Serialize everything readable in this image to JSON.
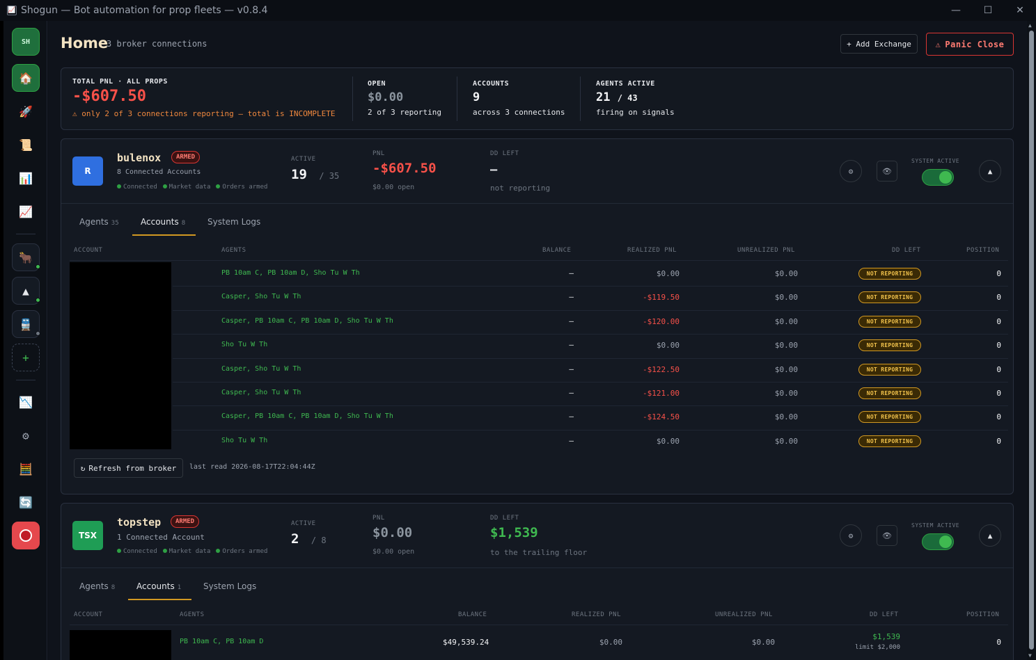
{
  "window": {
    "title": "Shogun — Bot automation for prop fleets — v0.8.4",
    "minimize": "—",
    "maximize": "☐",
    "close": "✕"
  },
  "sidebar": {
    "top_label": "SH",
    "items": [
      {
        "name": "home",
        "icon": "🏠"
      },
      {
        "name": "bots",
        "icon": "🚀"
      },
      {
        "name": "logs",
        "icon": "📜"
      },
      {
        "name": "stats",
        "icon": "📊"
      },
      {
        "name": "charts",
        "icon": "📈"
      },
      {
        "name": "bull-connection",
        "icon": "🐂"
      },
      {
        "name": "triangle-connection",
        "icon": "▲"
      },
      {
        "name": "train-connection",
        "icon": "🚆"
      },
      {
        "name": "add",
        "icon": "+"
      },
      {
        "name": "drawdown",
        "icon": "📉"
      },
      {
        "name": "settings",
        "icon": "⚙"
      },
      {
        "name": "calculator",
        "icon": "🧮"
      },
      {
        "name": "sync",
        "icon": "🔄"
      },
      {
        "name": "record",
        "icon": "⭕"
      }
    ]
  },
  "header": {
    "title": "Home",
    "subtitle": "3 broker connections",
    "add_exchange": "+ Add Exchange",
    "panic_close": "Panic Close",
    "panic_icon": "⚠"
  },
  "summary": {
    "total_label": "TOTAL PNL · ALL PROPS",
    "total_value": "-$607.50",
    "warning": "⚠ only 2 of 3 connections reporting — total is INCOMPLETE",
    "open_label": "OPEN",
    "open_value": "$0.00",
    "open_sub": "2 of 3 reporting",
    "accounts_label": "ACCOUNTS",
    "accounts_value": "9",
    "accounts_sub": "across 3 connections",
    "agents_label": "AGENTS ACTIVE",
    "agents_value": "21",
    "agents_total": "/ 43",
    "agents_sub": "firing on signals"
  },
  "connections": [
    {
      "logo": "R",
      "logo_color": "#2f6fe0",
      "name": "bulenox",
      "badge": "ARMED",
      "count_text": "8 Connected Accounts",
      "status": [
        "Connected",
        "Market data",
        "Orders armed"
      ],
      "active_label": "ACTIVE",
      "active_value": "19",
      "active_total": "/ 35",
      "pnl_label": "PNL",
      "pnl_value": "-$607.50",
      "pnl_sub": "$0.00 open",
      "dd_label": "DD LEFT",
      "dd_value": "—",
      "dd_sub": "not reporting",
      "system_active_label": "SYSTEM ACTIVE",
      "tabs": [
        {
          "label": "Agents",
          "count": "35"
        },
        {
          "label": "Accounts",
          "count": "8"
        },
        {
          "label": "System Logs",
          "count": ""
        }
      ],
      "columns": [
        "ACCOUNT",
        "AGENTS",
        "BALANCE",
        "REALIZED PNL",
        "UNREALIZED PNL",
        "DD LEFT",
        "POSITION"
      ],
      "rows": [
        {
          "agents": "PB 10am C, PB 10am D, Sho Tu W Th",
          "balance": "—",
          "realized": "$0.00",
          "unrealized": "$0.00",
          "dd": "NOT REPORTING",
          "position": "0"
        },
        {
          "agents": "Casper, Sho Tu W Th",
          "balance": "—",
          "realized": "-$119.50",
          "unrealized": "$0.00",
          "dd": "NOT REPORTING",
          "position": "0"
        },
        {
          "agents": "Casper, PB 10am C, PB 10am D, Sho Tu W Th",
          "balance": "—",
          "realized": "-$120.00",
          "unrealized": "$0.00",
          "dd": "NOT REPORTING",
          "position": "0"
        },
        {
          "agents": "Sho Tu W Th",
          "balance": "—",
          "realized": "$0.00",
          "unrealized": "$0.00",
          "dd": "NOT REPORTING",
          "position": "0"
        },
        {
          "agents": "Casper, Sho Tu W Th",
          "balance": "—",
          "realized": "-$122.50",
          "unrealized": "$0.00",
          "dd": "NOT REPORTING",
          "position": "0"
        },
        {
          "agents": "Casper, Sho Tu W Th",
          "balance": "—",
          "realized": "-$121.00",
          "unrealized": "$0.00",
          "dd": "NOT REPORTING",
          "position": "0"
        },
        {
          "agents": "Casper, PB 10am C, PB 10am D, Sho Tu W Th",
          "balance": "—",
          "realized": "-$124.50",
          "unrealized": "$0.00",
          "dd": "NOT REPORTING",
          "position": "0"
        },
        {
          "agents": "Sho Tu W Th",
          "balance": "—",
          "realized": "$0.00",
          "unrealized": "$0.00",
          "dd": "NOT REPORTING",
          "position": "0"
        }
      ],
      "refresh_label": "Refresh from broker",
      "refresh_icon": "↻",
      "last_read": "last read 2026-08-17T22:04:44Z"
    },
    {
      "logo": "TSX",
      "logo_color": "#1f9d55",
      "name": "topstep",
      "badge": "ARMED",
      "count_text": "1 Connected Account",
      "status": [
        "Connected",
        "Market data",
        "Orders armed"
      ],
      "active_label": "ACTIVE",
      "active_value": "2",
      "active_total": "/ 8",
      "pnl_label": "PNL",
      "pnl_value": "$0.00",
      "pnl_sub": "$0.00 open",
      "dd_label": "DD LEFT",
      "dd_value": "$1,539",
      "dd_sub": "to the trailing floor",
      "system_active_label": "SYSTEM ACTIVE",
      "tabs": [
        {
          "label": "Agents",
          "count": "8"
        },
        {
          "label": "Accounts",
          "count": "1"
        },
        {
          "label": "System Logs",
          "count": ""
        }
      ],
      "columns": [
        "ACCOUNT",
        "AGENTS",
        "BALANCE",
        "REALIZED PNL",
        "UNREALIZED PNL",
        "DD LEFT",
        "POSITION"
      ],
      "rows": [
        {
          "agents": "PB 10am C, PB 10am D",
          "balance": "$49,539.24",
          "realized": "$0.00",
          "unrealized": "$0.00",
          "dd": "$1,539",
          "dd_limit": "limit $2,000",
          "position": "0"
        }
      ]
    }
  ],
  "colors": {
    "positive": "#3fb950",
    "negative": "#f85149",
    "accent": "#d29922"
  }
}
